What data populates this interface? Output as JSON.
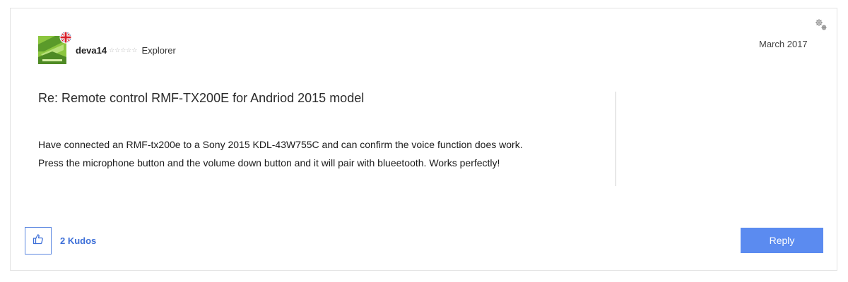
{
  "author": {
    "username": "deva14",
    "rank": "Explorer",
    "rank_stars": "☆☆☆☆☆",
    "avatar_icon": "avatar-image",
    "flag_icon": "uk-flag-icon"
  },
  "post": {
    "date": "March 2017",
    "subject": "Re: Remote control RMF-TX200E for Andriod 2015 model",
    "body": [
      "Have connected an RMF-tx200e to a Sony 2015 KDL-43W755C and can confirm the voice function does work.",
      "Press the microphone button and the volume down button and it will pair with blueetooth. Works perfectly!"
    ]
  },
  "kudos": {
    "count_label": "2 Kudos",
    "icon": "thumbs-up-icon"
  },
  "actions": {
    "reply_label": "Reply",
    "options_icon": "gear-icon"
  },
  "colors": {
    "accent": "#5b8bf0",
    "link": "#3d6fd8",
    "avatar_green": "#6cae3a"
  }
}
